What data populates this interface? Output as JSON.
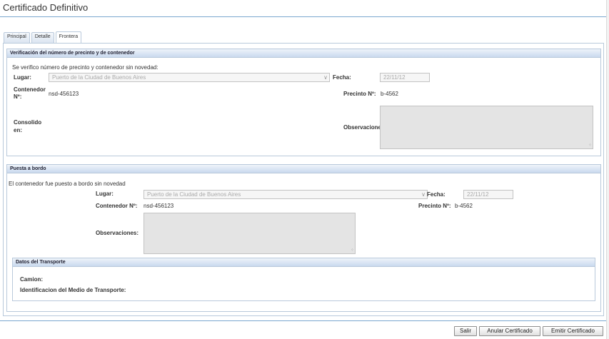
{
  "page": {
    "title": "Certificado Definitivo"
  },
  "tabs": [
    {
      "label": "Principal",
      "active": false
    },
    {
      "label": "Detalle",
      "active": false
    },
    {
      "label": "Frontera",
      "active": true
    }
  ],
  "verificacion": {
    "header": "Verificación del número de precinto y de contenedor",
    "subtitle": "Se verifico número de precinto y contenedor sin novedad:",
    "lugar_label": "Lugar:",
    "lugar_value": "Puerto de la Ciudad de Buenos Aires",
    "fecha_label": "Fecha:",
    "fecha_value": "22/11/12",
    "contenedor_label": "Contenedor Nº:",
    "contenedor_value": "nsd-456123",
    "precinto_label": "Precinto Nº:",
    "precinto_value": "b-4562",
    "consolido_label": "Consolido en:",
    "observaciones_label": "Observaciones:"
  },
  "puesta": {
    "header": "Puesta a bordo",
    "subtitle": "El contenedor fue puesto a bordo sin novedad",
    "lugar_label": "Lugar:",
    "lugar_value": "Puerto de la Ciudad de Buenos Aires",
    "fecha_label": "Fecha:",
    "fecha_value": "22/11/12",
    "contenedor_label": "Contenedor Nº:",
    "contenedor_value": "nsd-456123",
    "precinto_label": "Precinto Nº:",
    "precinto_value": "b-4562",
    "observaciones_label": "Observaciones:"
  },
  "transporte": {
    "header": "Datos del Transporte",
    "camion_label": "Camion:",
    "medio_label": "Identificacion del Medio de Transporte:"
  },
  "buttons": {
    "salir": "Salir",
    "anular": "Anular Certificado",
    "emitir": "Emitir Certificado"
  },
  "icons": {
    "dropdown": "chevron-down-icon",
    "resize": "resize-grip-icon"
  },
  "colors": {
    "accent_rule": "#7aa7cf",
    "panel_border": "#b9c9db",
    "disabled_field": "#f6f6f6"
  }
}
